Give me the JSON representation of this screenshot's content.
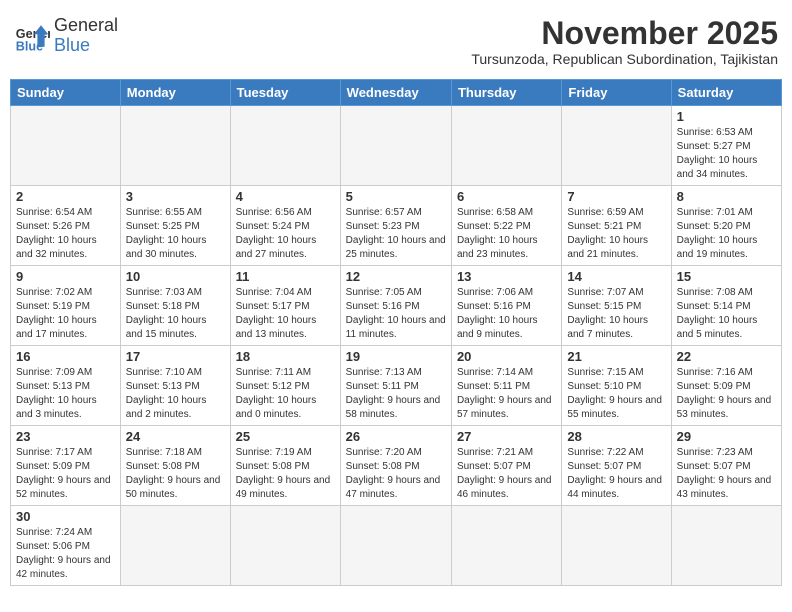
{
  "logo": {
    "line1": "General",
    "line2": "Blue"
  },
  "title": "November 2025",
  "subtitle": "Tursunzoda, Republican Subordination, Tajikistan",
  "days_of_week": [
    "Sunday",
    "Monday",
    "Tuesday",
    "Wednesday",
    "Thursday",
    "Friday",
    "Saturday"
  ],
  "weeks": [
    [
      {
        "day": "",
        "info": ""
      },
      {
        "day": "",
        "info": ""
      },
      {
        "day": "",
        "info": ""
      },
      {
        "day": "",
        "info": ""
      },
      {
        "day": "",
        "info": ""
      },
      {
        "day": "",
        "info": ""
      },
      {
        "day": "1",
        "info": "Sunrise: 6:53 AM\nSunset: 5:27 PM\nDaylight: 10 hours and 34 minutes."
      }
    ],
    [
      {
        "day": "2",
        "info": "Sunrise: 6:54 AM\nSunset: 5:26 PM\nDaylight: 10 hours and 32 minutes."
      },
      {
        "day": "3",
        "info": "Sunrise: 6:55 AM\nSunset: 5:25 PM\nDaylight: 10 hours and 30 minutes."
      },
      {
        "day": "4",
        "info": "Sunrise: 6:56 AM\nSunset: 5:24 PM\nDaylight: 10 hours and 27 minutes."
      },
      {
        "day": "5",
        "info": "Sunrise: 6:57 AM\nSunset: 5:23 PM\nDaylight: 10 hours and 25 minutes."
      },
      {
        "day": "6",
        "info": "Sunrise: 6:58 AM\nSunset: 5:22 PM\nDaylight: 10 hours and 23 minutes."
      },
      {
        "day": "7",
        "info": "Sunrise: 6:59 AM\nSunset: 5:21 PM\nDaylight: 10 hours and 21 minutes."
      },
      {
        "day": "8",
        "info": "Sunrise: 7:01 AM\nSunset: 5:20 PM\nDaylight: 10 hours and 19 minutes."
      }
    ],
    [
      {
        "day": "9",
        "info": "Sunrise: 7:02 AM\nSunset: 5:19 PM\nDaylight: 10 hours and 17 minutes."
      },
      {
        "day": "10",
        "info": "Sunrise: 7:03 AM\nSunset: 5:18 PM\nDaylight: 10 hours and 15 minutes."
      },
      {
        "day": "11",
        "info": "Sunrise: 7:04 AM\nSunset: 5:17 PM\nDaylight: 10 hours and 13 minutes."
      },
      {
        "day": "12",
        "info": "Sunrise: 7:05 AM\nSunset: 5:16 PM\nDaylight: 10 hours and 11 minutes."
      },
      {
        "day": "13",
        "info": "Sunrise: 7:06 AM\nSunset: 5:16 PM\nDaylight: 10 hours and 9 minutes."
      },
      {
        "day": "14",
        "info": "Sunrise: 7:07 AM\nSunset: 5:15 PM\nDaylight: 10 hours and 7 minutes."
      },
      {
        "day": "15",
        "info": "Sunrise: 7:08 AM\nSunset: 5:14 PM\nDaylight: 10 hours and 5 minutes."
      }
    ],
    [
      {
        "day": "16",
        "info": "Sunrise: 7:09 AM\nSunset: 5:13 PM\nDaylight: 10 hours and 3 minutes."
      },
      {
        "day": "17",
        "info": "Sunrise: 7:10 AM\nSunset: 5:13 PM\nDaylight: 10 hours and 2 minutes."
      },
      {
        "day": "18",
        "info": "Sunrise: 7:11 AM\nSunset: 5:12 PM\nDaylight: 10 hours and 0 minutes."
      },
      {
        "day": "19",
        "info": "Sunrise: 7:13 AM\nSunset: 5:11 PM\nDaylight: 9 hours and 58 minutes."
      },
      {
        "day": "20",
        "info": "Sunrise: 7:14 AM\nSunset: 5:11 PM\nDaylight: 9 hours and 57 minutes."
      },
      {
        "day": "21",
        "info": "Sunrise: 7:15 AM\nSunset: 5:10 PM\nDaylight: 9 hours and 55 minutes."
      },
      {
        "day": "22",
        "info": "Sunrise: 7:16 AM\nSunset: 5:09 PM\nDaylight: 9 hours and 53 minutes."
      }
    ],
    [
      {
        "day": "23",
        "info": "Sunrise: 7:17 AM\nSunset: 5:09 PM\nDaylight: 9 hours and 52 minutes."
      },
      {
        "day": "24",
        "info": "Sunrise: 7:18 AM\nSunset: 5:08 PM\nDaylight: 9 hours and 50 minutes."
      },
      {
        "day": "25",
        "info": "Sunrise: 7:19 AM\nSunset: 5:08 PM\nDaylight: 9 hours and 49 minutes."
      },
      {
        "day": "26",
        "info": "Sunrise: 7:20 AM\nSunset: 5:08 PM\nDaylight: 9 hours and 47 minutes."
      },
      {
        "day": "27",
        "info": "Sunrise: 7:21 AM\nSunset: 5:07 PM\nDaylight: 9 hours and 46 minutes."
      },
      {
        "day": "28",
        "info": "Sunrise: 7:22 AM\nSunset: 5:07 PM\nDaylight: 9 hours and 44 minutes."
      },
      {
        "day": "29",
        "info": "Sunrise: 7:23 AM\nSunset: 5:07 PM\nDaylight: 9 hours and 43 minutes."
      }
    ],
    [
      {
        "day": "30",
        "info": "Sunrise: 7:24 AM\nSunset: 5:06 PM\nDaylight: 9 hours and 42 minutes."
      },
      {
        "day": "",
        "info": ""
      },
      {
        "day": "",
        "info": ""
      },
      {
        "day": "",
        "info": ""
      },
      {
        "day": "",
        "info": ""
      },
      {
        "day": "",
        "info": ""
      },
      {
        "day": "",
        "info": ""
      }
    ]
  ]
}
